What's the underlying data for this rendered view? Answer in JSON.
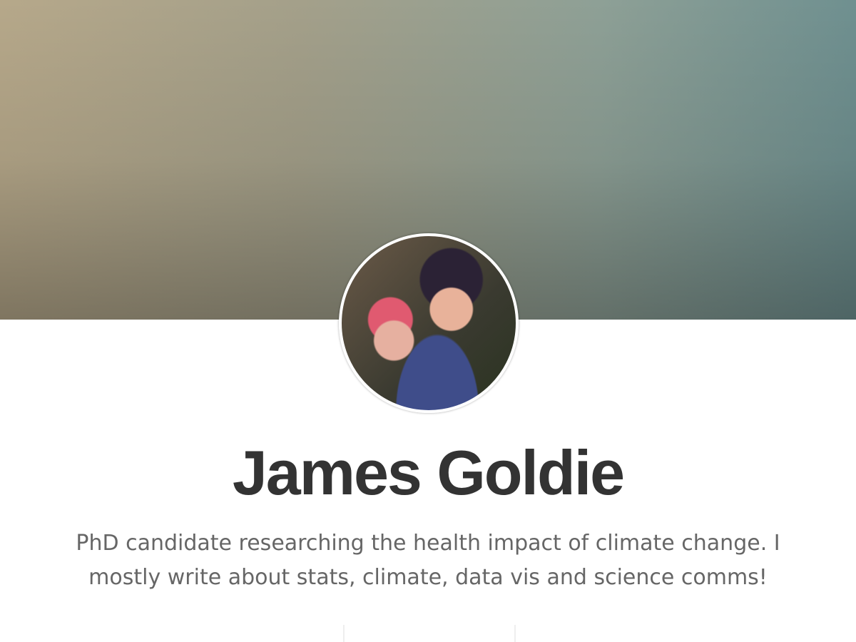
{
  "profile": {
    "name": "James Goldie",
    "bio": "PhD candidate researching the health impact of climate change. I mostly write about stats, climate, data vis and science comms!"
  }
}
